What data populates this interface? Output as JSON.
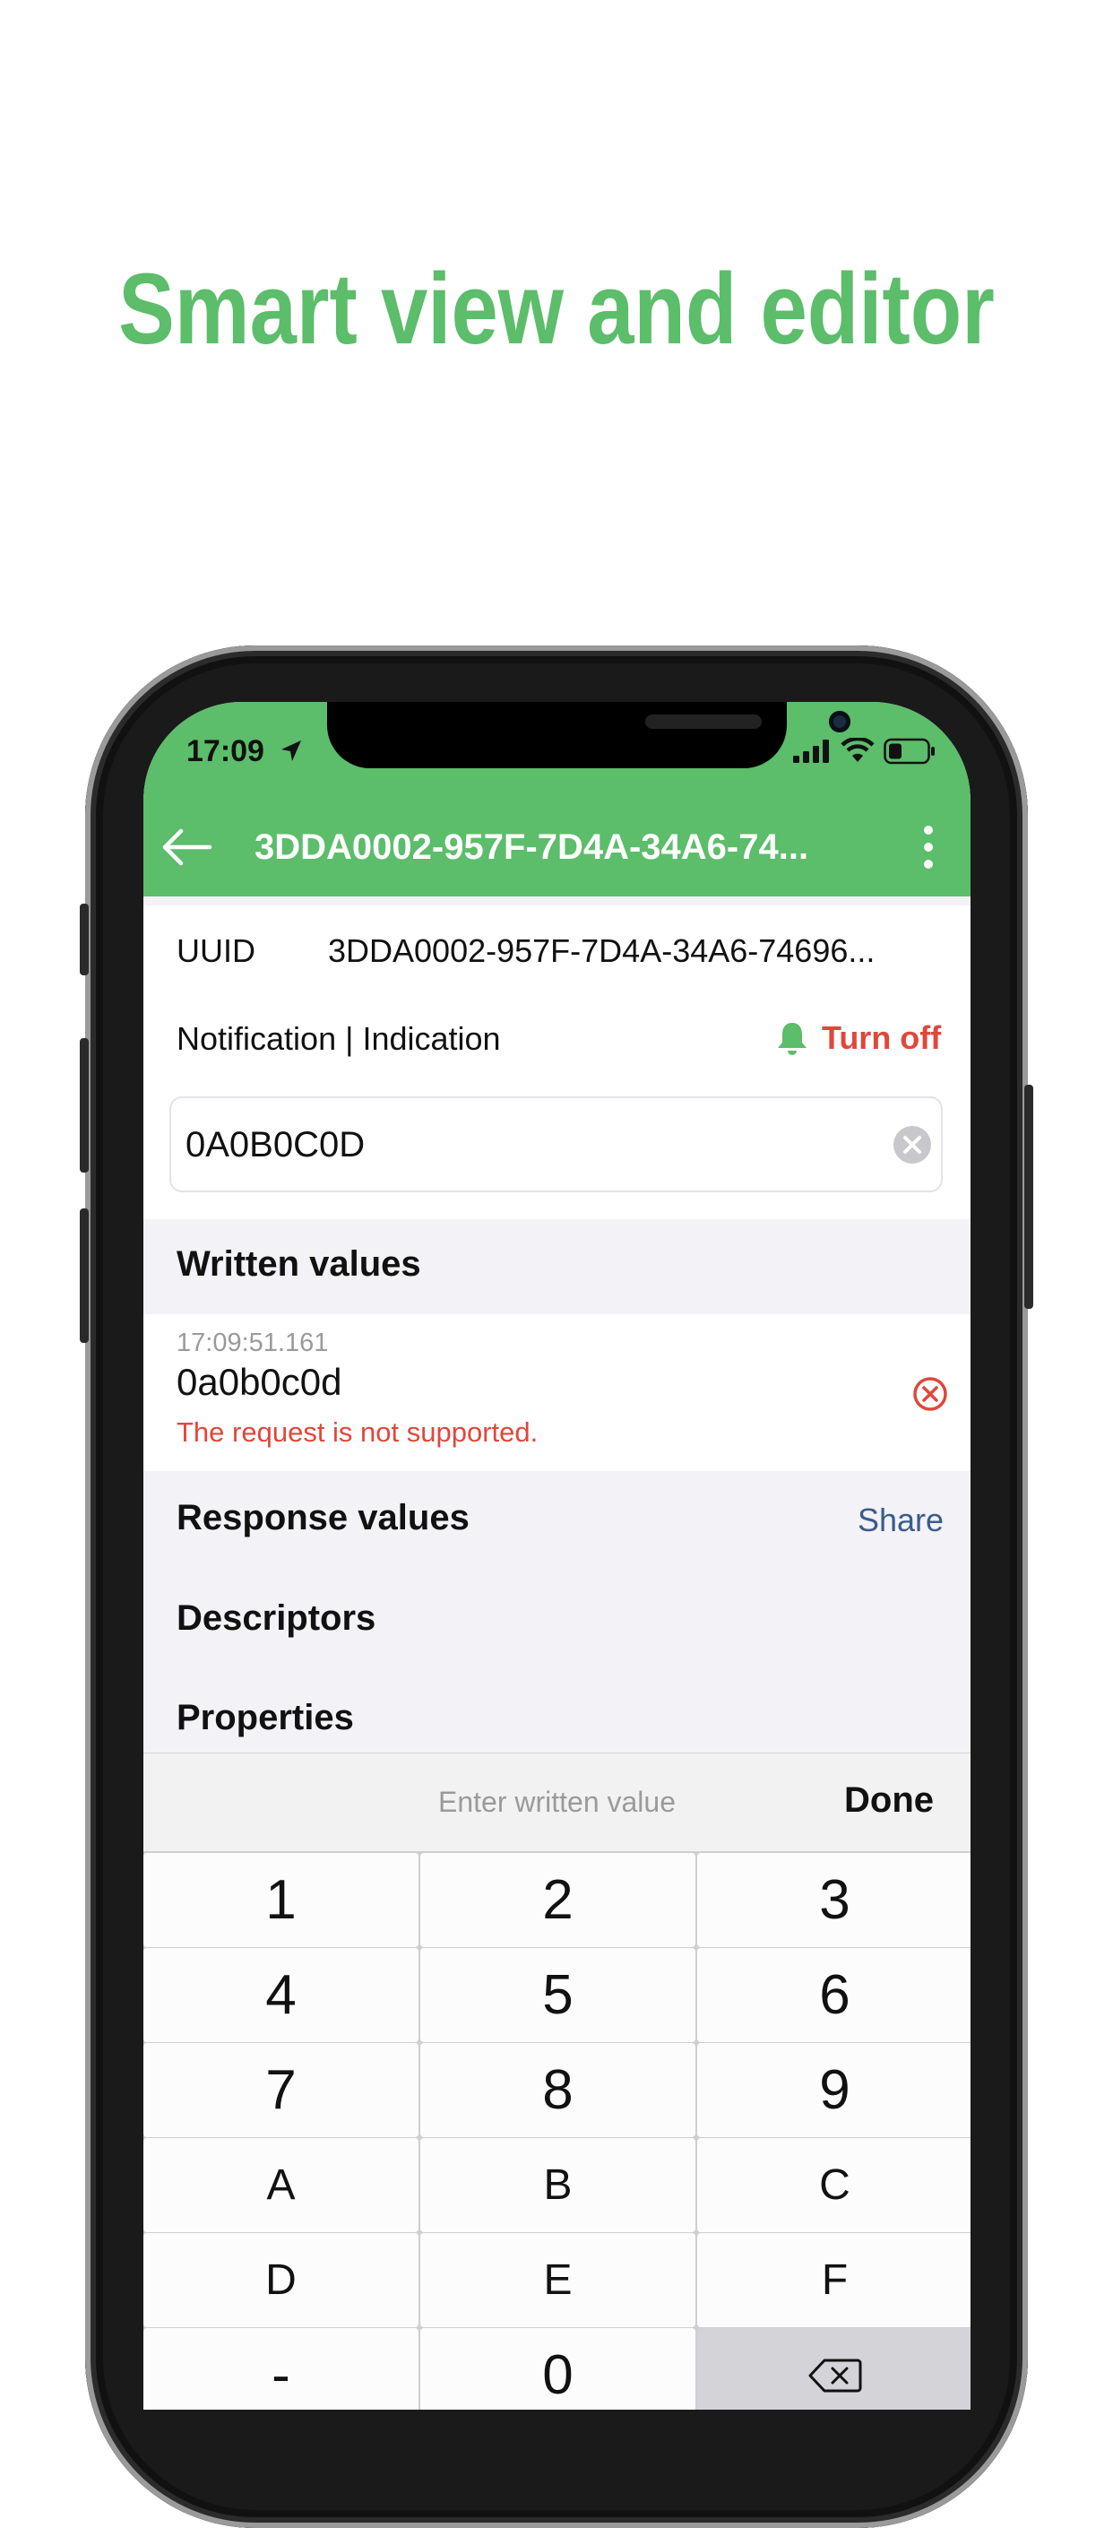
{
  "headline": "Smart view and editor",
  "status_bar": {
    "time": "17:09"
  },
  "nav": {
    "title": "3DDA0002-957F-7D4A-34A6-74..."
  },
  "uuid_row": {
    "label": "UUID",
    "value": "3DDA0002-957F-7D4A-34A6-74696..."
  },
  "notify_row": {
    "label": "Notification | Indication",
    "action": "Turn off"
  },
  "input": {
    "value": "0A0B0C0D"
  },
  "written": {
    "title": "Written values",
    "timestamp": "17:09:51.161",
    "value": "0a0b0c0d",
    "error": "The request is not supported."
  },
  "response": {
    "title": "Response values",
    "share": "Share"
  },
  "descriptors": {
    "title": "Descriptors"
  },
  "properties": {
    "title": "Properties"
  },
  "keyboard": {
    "placeholder": "Enter written value",
    "done": "Done",
    "keys": [
      "1",
      "2",
      "3",
      "4",
      "5",
      "6",
      "7",
      "8",
      "9",
      "A",
      "B",
      "C",
      "D",
      "E",
      "F",
      "-",
      "0"
    ]
  },
  "colors": {
    "accent": "#5cbd6a",
    "error": "#e0473b",
    "link": "#3b5b8c"
  }
}
